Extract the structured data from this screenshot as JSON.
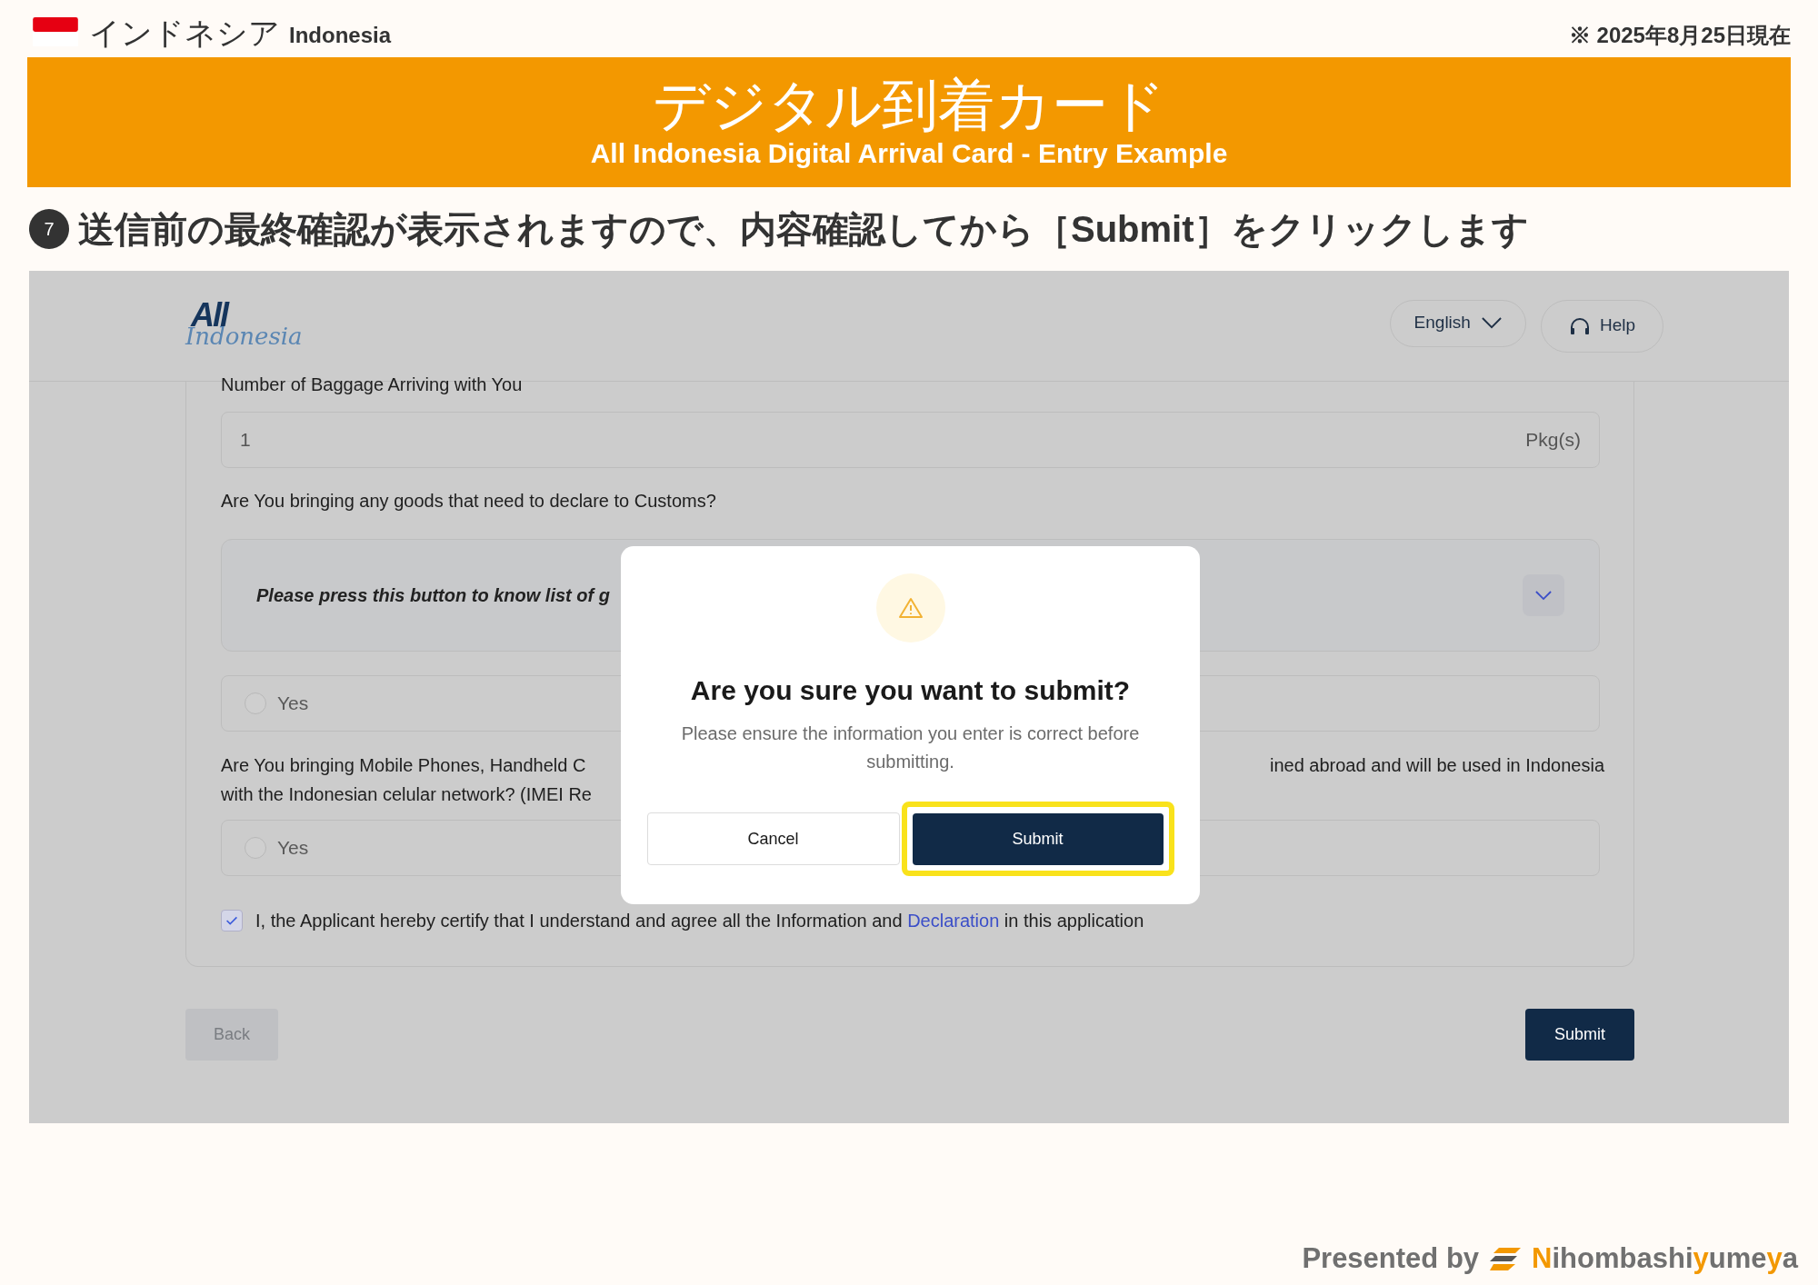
{
  "slide": {
    "country_ja": "インドネシア",
    "country_en": "Indonesia",
    "as_of": "※ 2025年8月25日現在",
    "title_ja": "デジタル到着カード",
    "title_en": "All Indonesia Digital Arrival Card - Entry Example",
    "step_number": "7",
    "step_text": "送信前の最終確認が表示されますので、内容確認してから［Submit］をクリックします",
    "presented_by": "Presented by",
    "brand": [
      {
        "text": "N",
        "accent": true
      },
      {
        "text": "ihombashi",
        "accent": false
      },
      {
        "text": "y",
        "accent": true
      },
      {
        "text": "ume",
        "accent": false
      },
      {
        "text": "y",
        "accent": true
      },
      {
        "text": "a",
        "accent": false
      }
    ]
  },
  "app": {
    "logo_top": "All",
    "logo_script": "Indonesia",
    "language": "English",
    "help": "Help",
    "form": {
      "baggage_label": "Number of Baggage Arriving with You",
      "baggage_value": "1",
      "baggage_unit": "Pkg(s)",
      "customs_question": "Are You bringing any goods that need to declare to Customs?",
      "accordion_text": "Please press this button to know list of g",
      "accordion_expanded": false,
      "customs_option": {
        "label": "Yes",
        "selected": false
      },
      "phones_question_line1_left": "Are You bringing Mobile Phones, Handheld C",
      "phones_question_line1_right": "ined abroad and will be used in Indonesia",
      "phones_question_line2_left": "with the Indonesian celular network? (IMEI Re",
      "phones_option": {
        "label": "Yes",
        "selected": false
      },
      "certify": {
        "checked": true,
        "before": "I, the Applicant hereby certify that I understand and agree all the Information and",
        "link": "Declaration",
        "after": "in this application"
      },
      "back": {
        "label": "Back",
        "disabled": true
      },
      "submit": "Submit"
    },
    "modal": {
      "title": "Are you sure you want to submit?",
      "message": "Please ensure the information you enter is correct before submitting.",
      "cancel": "Cancel",
      "submit": "Submit",
      "submit_highlighted": true
    }
  }
}
